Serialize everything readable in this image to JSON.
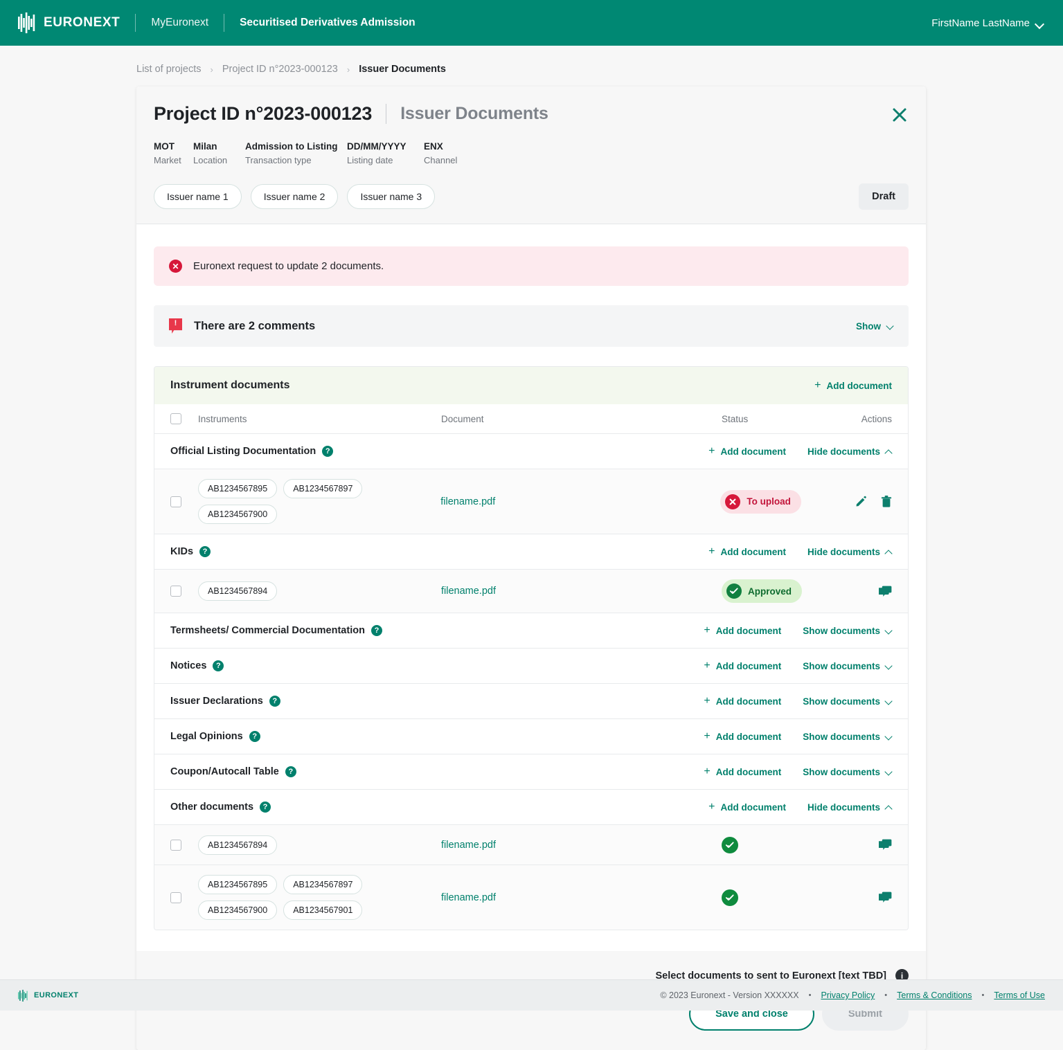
{
  "brand": {
    "name": "EURONEXT",
    "accent": "#008873"
  },
  "topbar": {
    "app_link": "MyEuronext",
    "app_title": "Securitised Derivatives Admission",
    "user": "FirstName LastName"
  },
  "breadcrumb": {
    "items": [
      "List of projects",
      "Project ID n°2023-000123",
      "Issuer Documents"
    ],
    "separator": "›"
  },
  "card": {
    "title_main": "Project ID n°2023-000123",
    "title_sub": "Issuer Documents",
    "meta": [
      {
        "value": "MOT",
        "label": "Market"
      },
      {
        "value": "Milan",
        "label": "Location"
      },
      {
        "value": "Admission to Listing",
        "label": "Transaction type"
      },
      {
        "value": "DD/MM/YYYY",
        "label": "Listing date"
      },
      {
        "value": "ENX",
        "label": "Channel"
      }
    ],
    "issuers": [
      "Issuer name 1",
      "Issuer name 2",
      "Issuer name 3"
    ],
    "status_badge": "Draft"
  },
  "alert": {
    "text": "Euronext request to update 2 documents.",
    "color": "#d6173a"
  },
  "comments": {
    "title": "There are 2 comments",
    "toggle_label": "Show"
  },
  "table": {
    "section_title": "Instrument documents",
    "add_document_label": "Add document",
    "headers": {
      "instruments": "Instruments",
      "document": "Document",
      "status": "Status",
      "actions": "Actions"
    },
    "labels": {
      "add_document": "Add document",
      "hide_documents": "Hide documents",
      "show_documents": "Show documents"
    },
    "groups": [
      {
        "name": "Official Listing Documentation",
        "expanded": true,
        "toggle_label": "Hide documents",
        "rows": [
          {
            "instruments": [
              "AB1234567895",
              "AB1234567897",
              "AB1234567900"
            ],
            "document": "filename.pdf",
            "status": "To upload",
            "status_type": "red",
            "actions": [
              "edit-icon",
              "delete-icon"
            ]
          }
        ]
      },
      {
        "name": "KIDs",
        "expanded": true,
        "toggle_label": "Hide documents",
        "rows": [
          {
            "instruments": [
              "AB1234567894"
            ],
            "document": "filename.pdf",
            "status": "Approved",
            "status_type": "green",
            "actions": [
              "comment-icon"
            ]
          }
        ]
      },
      {
        "name": "Termsheets/ Commercial Documentation",
        "expanded": false,
        "toggle_label": "Show documents",
        "rows": []
      },
      {
        "name": "Notices",
        "expanded": false,
        "toggle_label": "Show documents",
        "rows": []
      },
      {
        "name": "Issuer Declarations",
        "expanded": false,
        "toggle_label": "Show documents",
        "rows": []
      },
      {
        "name": "Legal Opinions",
        "expanded": false,
        "toggle_label": "Show documents",
        "rows": []
      },
      {
        "name": "Coupon/Autocall Table",
        "expanded": false,
        "toggle_label": "Show documents",
        "rows": []
      },
      {
        "name": "Other documents",
        "expanded": true,
        "toggle_label": "Hide documents",
        "rows": [
          {
            "instruments": [
              "AB1234567894"
            ],
            "document": "filename.pdf",
            "status": "",
            "status_type": "check",
            "actions": [
              "comment-icon"
            ]
          },
          {
            "instruments": [
              "AB1234567895",
              "AB1234567897",
              "AB1234567900",
              "AB1234567901"
            ],
            "document": "filename.pdf",
            "status": "",
            "status_type": "check",
            "actions": [
              "comment-icon"
            ]
          }
        ]
      }
    ]
  },
  "card_footer": {
    "note": "Select documents to sent to Euronext [text TBD]",
    "save_label": "Save and close",
    "submit_label": "Submit"
  },
  "page_footer": {
    "brand": "EURONEXT",
    "copyright": "© 2023 Euronext - Version XXXXXX",
    "links": [
      "Privacy Policy",
      "Terms & Conditions",
      "Terms of Use"
    ]
  }
}
